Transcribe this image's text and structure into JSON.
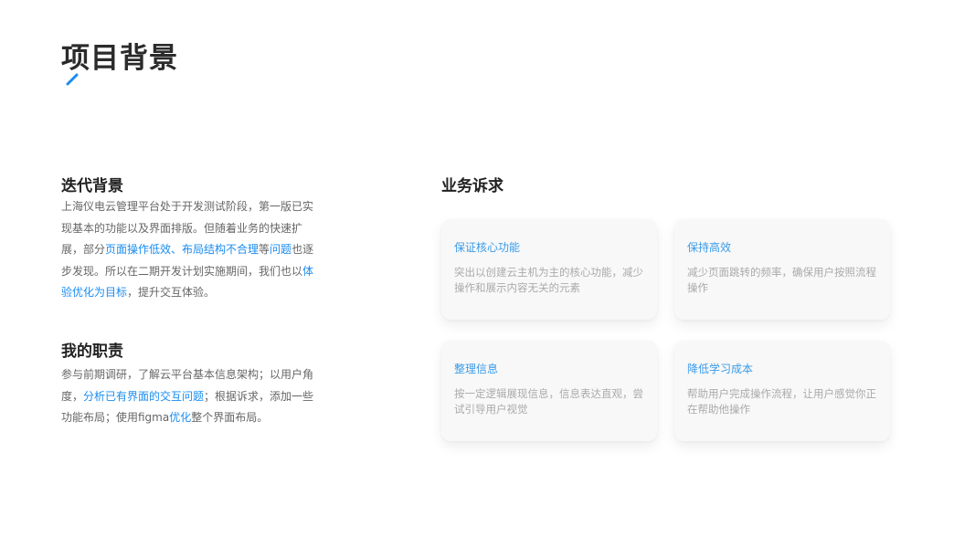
{
  "page": {
    "title": "项目背景"
  },
  "iteration": {
    "heading": "迭代背景",
    "p1": "上海仪电云管理平台处于开发测试阶段，第一版已实现基本的功能以及界面排版。但随着业务的快速扩展，部分",
    "hl1": "页面操作低效、布局结构不合理",
    "p2": "等",
    "hl2": "问题",
    "p3": "也逐步发现。所以在二期开发计划实施期间，我们也以",
    "hl3": "体验优化为目标",
    "p4": "，提升交互体验。"
  },
  "duty": {
    "heading": "我的职责",
    "p1": "参与前期调研，了解云平台基本信息架构；以用户角度，",
    "hl1": "分析已有界面的交互问题",
    "p2": "；根据诉求，添加一些功能布局；使用figma",
    "hl2": "优化",
    "p3": "整个界面布局。"
  },
  "business": {
    "heading": "业务诉求",
    "cards": [
      {
        "title": "保证核心功能",
        "desc": "突出以创建云主机为主的核心功能，减少操作和展示内容无关的元素"
      },
      {
        "title": "保持高效",
        "desc": "减少页面跳转的频率，确保用户按照流程操作"
      },
      {
        "title": "整理信息",
        "desc": "按一定逻辑展现信息，信息表达直观，尝试引导用户视觉"
      },
      {
        "title": "降低学习成本",
        "desc": "帮助用户完成操作流程，让用户感觉你正在帮助他操作"
      }
    ]
  },
  "colors": {
    "accent": "#1a8cf0",
    "card_title": "#3a9be8",
    "card_bg": "#f8f8f8"
  },
  "icons": {
    "title_accent": "pencil-stroke-icon"
  }
}
